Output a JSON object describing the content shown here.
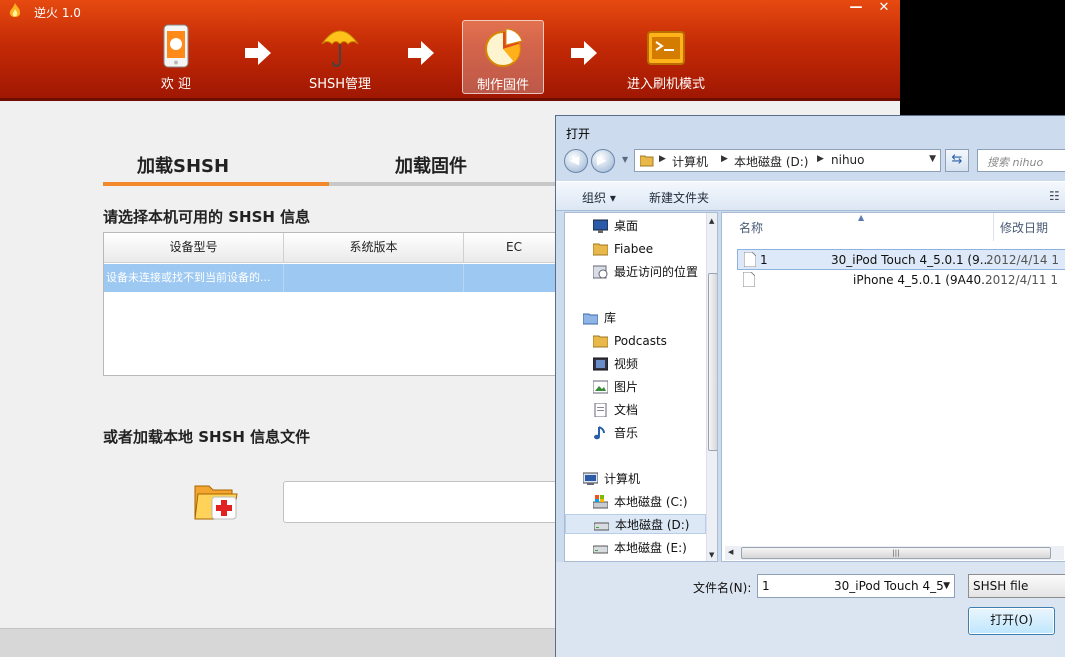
{
  "app": {
    "title": "逆火 1.0",
    "window_controls": {
      "minimize": "—",
      "close": "✕"
    },
    "steps": [
      {
        "label": "欢 迎",
        "icon": "phone-icon"
      },
      {
        "label": "SHSH管理",
        "icon": "umbrella-icon"
      },
      {
        "label": "制作固件",
        "icon": "pie-chart-icon",
        "active": true
      },
      {
        "label": "进入刷机模式",
        "icon": "console-icon"
      }
    ],
    "tabs": [
      "加载SHSH",
      "加载固件"
    ],
    "active_tab": 0,
    "section1_title": "请选择本机可用的 SHSH 信息",
    "table_headers": [
      "设备型号",
      "系统版本",
      "EC"
    ],
    "table_rows": [
      [
        "设备未连接或找不到当前设备的...",
        "",
        ""
      ]
    ],
    "section2_title": "或者加载本地 SHSH 信息文件",
    "path_value": ""
  },
  "dialog": {
    "title": "打开",
    "breadcrumb": [
      "计算机",
      "本地磁盘 (D:)",
      "nihuo"
    ],
    "search_placeholder": "搜索 nihuo",
    "toolbar": {
      "organize": "组织 ▾",
      "new_folder": "新建文件夹"
    },
    "nav_items": [
      {
        "label": "桌面",
        "icon": "desktop-icon"
      },
      {
        "label": "Fiabee",
        "icon": "folder-icon"
      },
      {
        "label": "最近访问的位置",
        "icon": "recent-places-icon"
      },
      {
        "label": "库",
        "icon": "library-icon"
      },
      {
        "label": "Podcasts",
        "icon": "folder-icon"
      },
      {
        "label": "视频",
        "icon": "video-icon"
      },
      {
        "label": "图片",
        "icon": "pictures-icon"
      },
      {
        "label": "文档",
        "icon": "documents-icon"
      },
      {
        "label": "音乐",
        "icon": "music-icon"
      },
      {
        "label": "计算机",
        "icon": "computer-icon"
      },
      {
        "label": "本地磁盘 (C:)",
        "icon": "system-drive-icon"
      },
      {
        "label": "本地磁盘 (D:)",
        "icon": "drive-icon",
        "selected": true
      },
      {
        "label": "本地磁盘 (E:)",
        "icon": "drive-icon"
      }
    ],
    "columns": {
      "name": "名称",
      "date": "修改日期"
    },
    "files": [
      {
        "name_start": "1",
        "name_end": "30_iPod Touch 4_5.0.1 (9...",
        "date": "2012/4/14 1",
        "selected": true
      },
      {
        "name_start": "",
        "name_end": "iPhone 4_5.0.1 (9A40...",
        "date": "2012/4/11 1"
      }
    ],
    "filename_label": "文件名(N):",
    "filename_value_start": "1",
    "filename_value_end": "30_iPod Touch 4_5",
    "filter": "SHSH file",
    "open_button": "打开(O)"
  },
  "colors": {
    "header_red": "#c42a06",
    "tab_accent": "#f28a2c",
    "row_selected": "#9cc8f2",
    "dialog_frame": "#ccdcee"
  }
}
